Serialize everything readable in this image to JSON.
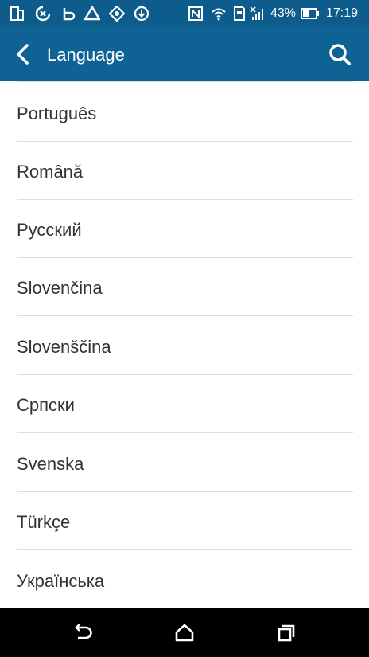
{
  "status_bar": {
    "battery_percent": "43%",
    "time": "17:19",
    "icons": [
      "sim-icon",
      "sync-icon",
      "bluetooth-icon",
      "drive-icon",
      "nav-icon",
      "download-icon",
      "nfc-icon",
      "wifi-icon",
      "sd-card-icon",
      "signal-icon",
      "battery-icon"
    ]
  },
  "app_bar": {
    "title": "Language",
    "back_icon": "back-arrow-icon",
    "search_icon": "search-icon"
  },
  "languages": [
    "Português",
    "Română",
    "Русский",
    "Slovenčina",
    "Slovenščina",
    "Српски",
    "Svenska",
    "Türkçe",
    "Українська"
  ],
  "nav_bar": {
    "icons": [
      "back-nav-icon",
      "home-icon",
      "recents-icon"
    ]
  },
  "colors": {
    "status_bar": "#0d5c8c",
    "app_bar": "#0f6294",
    "text": "#333333",
    "divider": "#dcdcdc",
    "nav_bar": "#000000"
  }
}
